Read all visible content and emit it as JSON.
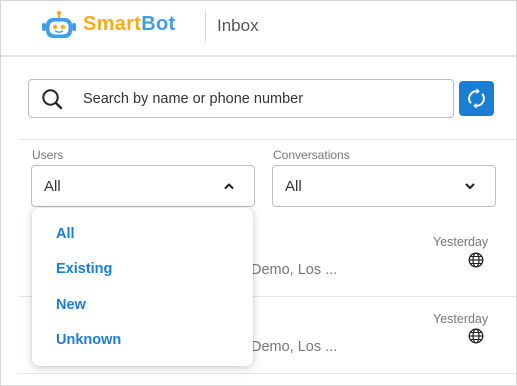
{
  "header": {
    "brand_part1": "Smart",
    "brand_part2": "Bot",
    "title": "Inbox"
  },
  "search": {
    "placeholder": "Search by name or phone number",
    "value": ""
  },
  "filters": {
    "users": {
      "label": "Users",
      "selected": "All",
      "expanded": true
    },
    "conversations": {
      "label": "Conversations",
      "selected": "All",
      "expanded": false
    }
  },
  "users_dropdown": {
    "options": [
      "All",
      "Existing",
      "New",
      "Unknown"
    ]
  },
  "conversations_list": [
    {
      "time": "Yesterday",
      "snippet": "Demo, Los ...",
      "icon": "globe-icon"
    },
    {
      "time": "Yesterday",
      "snippet": "Demo, Los ...",
      "icon": "globe-icon"
    }
  ],
  "colors": {
    "brand_orange": "#f4ad1c",
    "brand_blue": "#3f9ee8",
    "accent": "#1a7fd4"
  }
}
